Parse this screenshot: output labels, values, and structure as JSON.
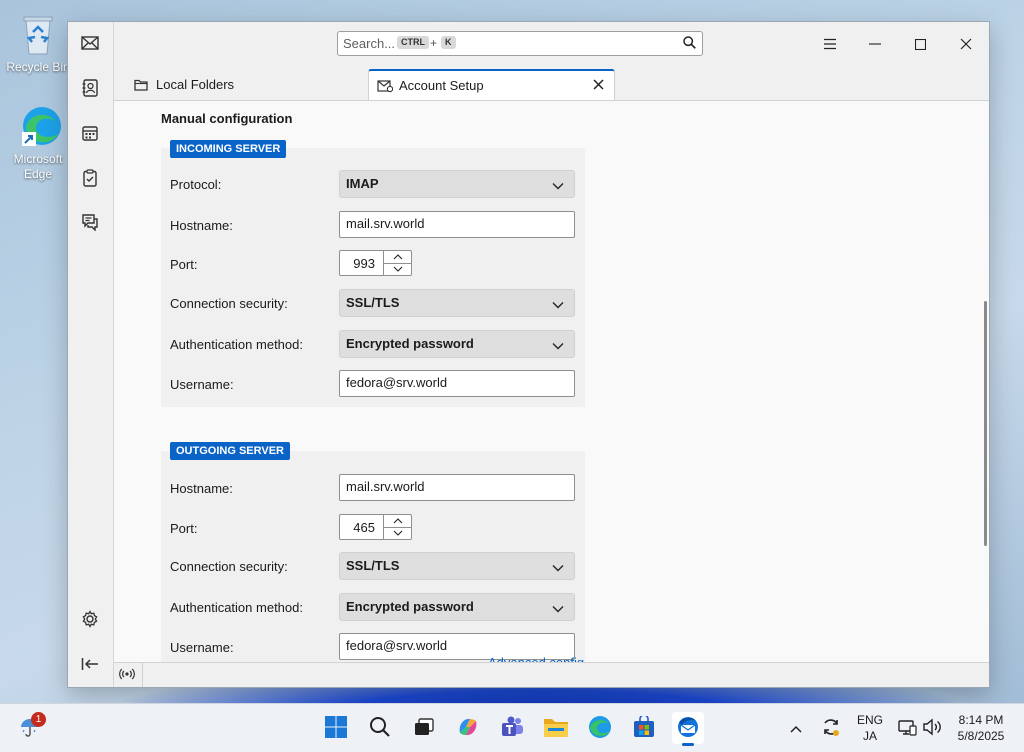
{
  "desktop": {
    "icons": [
      {
        "label": "Recycle Bin"
      },
      {
        "label": "Microsoft Edge"
      }
    ]
  },
  "window": {
    "search_placeholder": "Search...",
    "shortcut_key1": "CTRL",
    "shortcut_plus": "+",
    "shortcut_key2": "K",
    "tabs": [
      {
        "label": "Local Folders"
      },
      {
        "label": "Account Setup"
      }
    ]
  },
  "form": {
    "title": "Manual configuration",
    "incoming": {
      "heading": "INCOMING SERVER",
      "protocol_label": "Protocol:",
      "protocol_value": "IMAP",
      "hostname_label": "Hostname:",
      "hostname_value": "mail.srv.world",
      "port_label": "Port:",
      "port_value": "993",
      "security_label": "Connection security:",
      "security_value": "SSL/TLS",
      "auth_label": "Authentication method:",
      "auth_value": "Encrypted password",
      "username_label": "Username:",
      "username_value": "fedora@srv.world"
    },
    "outgoing": {
      "heading": "OUTGOING SERVER",
      "hostname_label": "Hostname:",
      "hostname_value": "mail.srv.world",
      "port_label": "Port:",
      "port_value": "465",
      "security_label": "Connection security:",
      "security_value": "SSL/TLS",
      "auth_label": "Authentication method:",
      "auth_value": "Encrypted password",
      "username_label": "Username:",
      "username_value": "fedora@srv.world"
    },
    "advanced_link": "Advanced config"
  },
  "taskbar": {
    "notification_count": "1",
    "lang_top": "ENG",
    "lang_bottom": "JA",
    "time": "8:14 PM",
    "date": "5/8/2025"
  },
  "colors": {
    "accent": "#0a64c8"
  }
}
